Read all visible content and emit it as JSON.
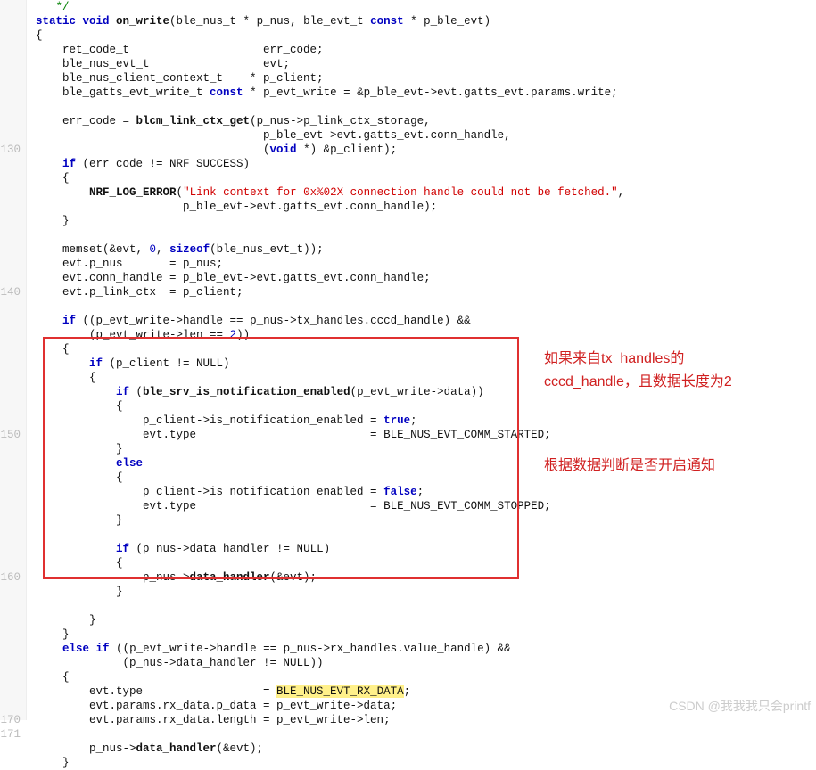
{
  "lineNumbers": [
    "130",
    "140",
    "150",
    "160",
    "170",
    "171"
  ],
  "lineNumberRows": [
    10,
    20,
    30,
    40,
    50,
    51
  ],
  "annotations": {
    "a1_l1": "如果来自tx_handles的",
    "a1_l2": "cccd_handle，且数据长度为2",
    "a2": "根据数据判断是否开启通知"
  },
  "watermark": "CSDN @我我我只会printf",
  "code": {
    "l0": "   */",
    "l1a": "static",
    "l1b": " void",
    "l1c": " on_write",
    "l1d": "(ble_nus_t * p_nus, ble_evt_t ",
    "l1e": "const",
    "l1f": " * p_ble_evt)",
    "l2": "{",
    "l3": "    ret_code_t                    err_code;",
    "l4": "    ble_nus_evt_t                 evt;",
    "l5": "    ble_nus_client_context_t    * p_client;",
    "l6a": "    ble_gatts_evt_write_t ",
    "l6b": "const",
    "l6c": " * p_evt_write = &p_ble_evt->evt.gatts_evt.params.write;",
    "l7": "",
    "l8a": "    err_code = ",
    "l8b": "blcm_link_ctx_get",
    "l8c": "(p_nus->p_link_ctx_storage,",
    "l9": "                                  p_ble_evt->evt.gatts_evt.conn_handle,",
    "l10a": "                                  (",
    "l10b": "void",
    "l10c": " *) &p_client);",
    "l11a": "    ",
    "l11b": "if",
    "l11c": " (err_code != NRF_SUCCESS)",
    "l12": "    {",
    "l13a": "        ",
    "l13b": "NRF_LOG_ERROR",
    "l13c": "(",
    "l13d": "\"Link context for 0x%02X connection handle could not be fetched.\"",
    "l13e": ",",
    "l14": "                      p_ble_evt->evt.gatts_evt.conn_handle);",
    "l15": "    }",
    "l16": "",
    "l17a": "    memset(&evt, ",
    "l17b": "0",
    "l17c": ", ",
    "l17d": "sizeof",
    "l17e": "(ble_nus_evt_t));",
    "l18": "    evt.p_nus       = p_nus;",
    "l19": "    evt.conn_handle = p_ble_evt->evt.gatts_evt.conn_handle;",
    "l20": "    evt.p_link_ctx  = p_client;",
    "l21": "",
    "l22a": "    ",
    "l22b": "if",
    "l22c": " ((p_evt_write->handle == p_nus->tx_handles.cccd_handle) &&",
    "l23a": "        (p_evt_write->len == ",
    "l23b": "2",
    "l23c": "))",
    "l24": "    {",
    "l25a": "        ",
    "l25b": "if",
    "l25c": " (p_client != NULL)",
    "l26": "        {",
    "l27a": "            ",
    "l27b": "if",
    "l27c": " (",
    "l27d": "ble_srv_is_notification_enabled",
    "l27e": "(p_evt_write->data))",
    "l28": "            {",
    "l29a": "                p_client->is_notification_enabled = ",
    "l29b": "true",
    "l29c": ";",
    "l30": "                evt.type                          = BLE_NUS_EVT_COMM_STARTED;",
    "l31": "            }",
    "l32a": "            ",
    "l32b": "else",
    "l33": "            {",
    "l34a": "                p_client->is_notification_enabled = ",
    "l34b": "false",
    "l34c": ";",
    "l35": "                evt.type                          = BLE_NUS_EVT_COMM_STOPPED;",
    "l36": "            }",
    "l37": "",
    "l38a": "            ",
    "l38b": "if",
    "l38c": " (p_nus->data_handler != NULL)",
    "l39": "            {",
    "l40a": "                p_nus->",
    "l40b": "data_handler",
    "l40c": "(&evt);",
    "l41": "            }",
    "l42": "",
    "l43": "        }",
    "l44": "    }",
    "l45a": "    ",
    "l45b": "else",
    "l45c": " ",
    "l45d": "if",
    "l45e": " ((p_evt_write->handle == p_nus->rx_handles.value_handle) &&",
    "l46": "             (p_nus->data_handler != NULL))",
    "l47": "    {",
    "l48a": "        evt.type                  = ",
    "l48b": "BLE_NUS_EVT_RX_DATA",
    "l48c": ";",
    "l49": "        evt.params.rx_data.p_data = p_evt_write->data;",
    "l50": "        evt.params.rx_data.length = p_evt_write->len;",
    "l51": "",
    "l52a": "        p_nus->",
    "l52b": "data_handler",
    "l52c": "(&evt);",
    "l53": "    }"
  }
}
